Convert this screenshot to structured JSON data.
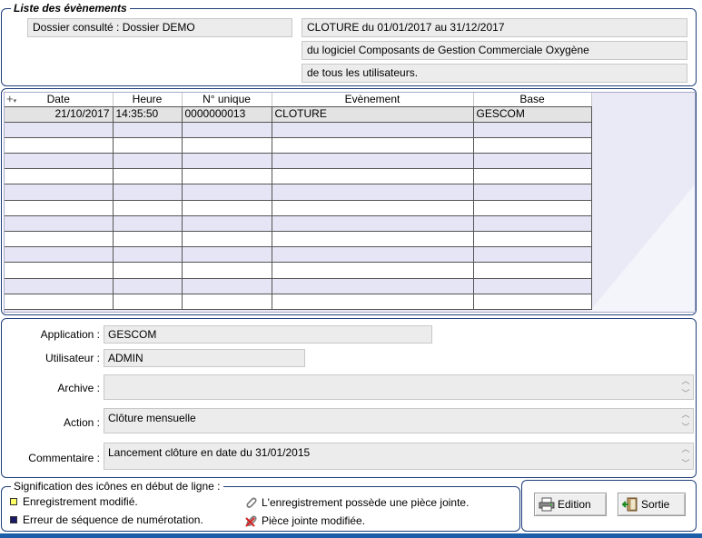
{
  "events_panel": {
    "title": "Liste des évènements",
    "dossier_label": "Dossier consulté : Dossier DEMO",
    "info_lines": [
      "CLOTURE du 01/01/2017 au 31/12/2017",
      "du logiciel Composants de Gestion Commerciale Oxygène",
      "de tous les utilisateurs."
    ]
  },
  "grid": {
    "columns": [
      "Date",
      "Heure",
      "N° unique",
      "Evènement",
      "Base"
    ],
    "rows": [
      [
        "21/10/2017",
        "14:35:50",
        "0000000013",
        "CLOTURE",
        "GESCOM"
      ]
    ],
    "empty_rows": 12
  },
  "details": {
    "application_label": "Application :",
    "application_value": "GESCOM",
    "user_label": "Utilisateur :",
    "user_value": "ADMIN",
    "archive_label": "Archive :",
    "archive_value": "",
    "action_label": "Action :",
    "action_value": "Clôture mensuelle",
    "comment_label": "Commentaire :",
    "comment_value": "Lancement clôture en date du 31/01/2015"
  },
  "icon_legend": {
    "title": "Signification des icônes en début de ligne :",
    "modified_label": "Enregistrement modifié.",
    "modified_color": "#ffff66",
    "sequence_error_label": "Erreur de séquence de numérotation.",
    "sequence_error_color": "#1a1a66",
    "attachment_label": "L'enregistrement possède une pièce jointe.",
    "attachment_modified_label": "Pièce jointe modifiée."
  },
  "actions": {
    "edition_label": "Edition",
    "sortie_label": "Sortie"
  }
}
